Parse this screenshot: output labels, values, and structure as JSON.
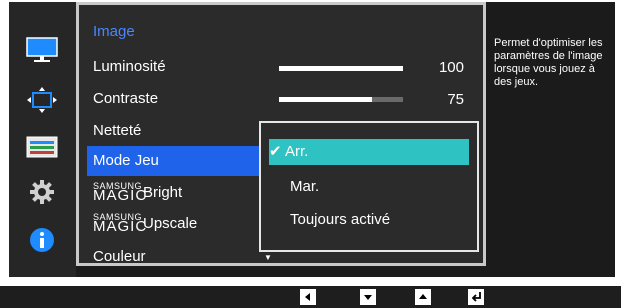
{
  "menu": {
    "title": "Image",
    "items": [
      {
        "label": "Luminosité",
        "value": "100",
        "level": 1.0
      },
      {
        "label": "Contraste",
        "value": "75",
        "level": 0.75
      },
      {
        "label": "Netteté"
      },
      {
        "label": "Mode Jeu"
      },
      {
        "brand": "SAMSUNG",
        "magic": "MAGIC",
        "label": "Bright"
      },
      {
        "brand": "SAMSUNG",
        "magic": "MAGIC",
        "label": "Upscale"
      },
      {
        "label": "Couleur"
      }
    ]
  },
  "submenu": {
    "options": [
      "Arr.",
      "Mar.",
      "Toujours activé"
    ],
    "selected": "Arr."
  },
  "help": {
    "text": "Permet d'optimiser les paramètres de l'image lorsque vous jouez à des jeux."
  },
  "sidebar_icons": [
    "monitor-icon",
    "position-icon",
    "system-icon",
    "gear-icon",
    "info-icon"
  ],
  "nav_buttons": [
    "left-icon",
    "down-icon",
    "up-icon",
    "enter-icon"
  ],
  "colors": {
    "highlight": "#1e63e9",
    "submenu_highlight": "#2ec3c2",
    "title": "#4a86ff"
  }
}
